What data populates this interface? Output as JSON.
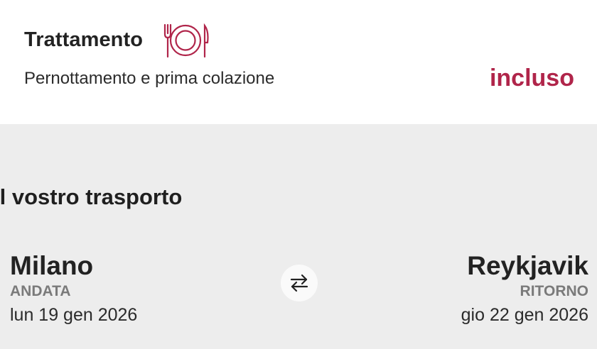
{
  "board": {
    "title": "Trattamento",
    "icon": "place-setting-icon",
    "description": "Pernottamento e prima colazione",
    "price_label": "incluso",
    "accent_color": "#b0254a"
  },
  "transport": {
    "title": "Il vostro trasporto",
    "swap_icon": "swap-arrows-icon",
    "outbound": {
      "city": "Milano",
      "kind": "ANDATA",
      "date": "lun 19 gen 2026"
    },
    "return": {
      "city": "Reykjavik",
      "kind": "RITORNO",
      "date": "gio 22 gen 2026"
    }
  }
}
